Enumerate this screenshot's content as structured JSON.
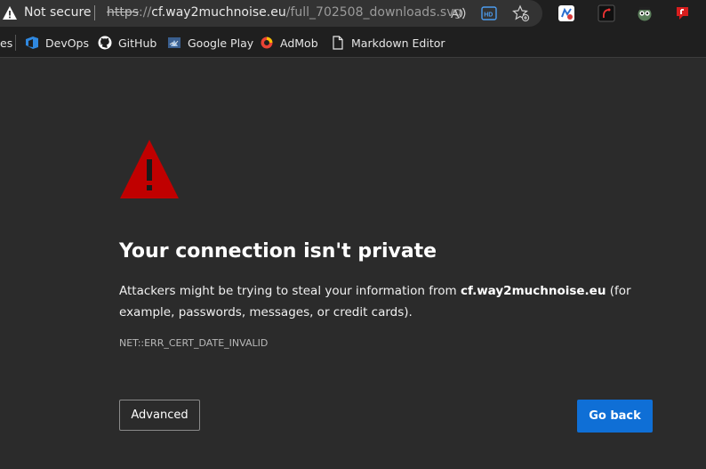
{
  "address_bar": {
    "security_label": "Not secure",
    "url_scheme": "https",
    "url_sep": "://",
    "url_host": "cf.way2muchnoise.eu",
    "url_path": "/full_702508_downloads.svg"
  },
  "toolbar_icons": [
    "read-aloud-icon",
    "hd-icon",
    "favorites-add-icon"
  ],
  "extensions": [
    "extension-1-icon",
    "extension-2-icon",
    "extension-3-icon",
    "extension-4-icon"
  ],
  "bookmarks": {
    "partial_label": "es",
    "items": [
      {
        "label": "DevOps",
        "icon": "devops-icon"
      },
      {
        "label": "GitHub",
        "icon": "github-icon"
      },
      {
        "label": "Google Play",
        "icon": "google-play-icon"
      },
      {
        "label": "AdMob",
        "icon": "admob-icon"
      },
      {
        "label": "Markdown Editor",
        "icon": "document-icon"
      }
    ]
  },
  "error_page": {
    "heading": "Your connection isn't private",
    "message_prefix": "Attackers might be trying to steal your information from ",
    "message_host": "cf.way2muchnoise.eu",
    "message_suffix": " (for example, passwords, messages, or credit cards).",
    "error_code": "NET::ERR_CERT_DATE_INVALID",
    "advanced_label": "Advanced",
    "go_back_label": "Go back"
  },
  "colors": {
    "page_bg": "#2b2b2b",
    "alert_red": "#c00000",
    "primary_button": "#0f6fd6"
  }
}
